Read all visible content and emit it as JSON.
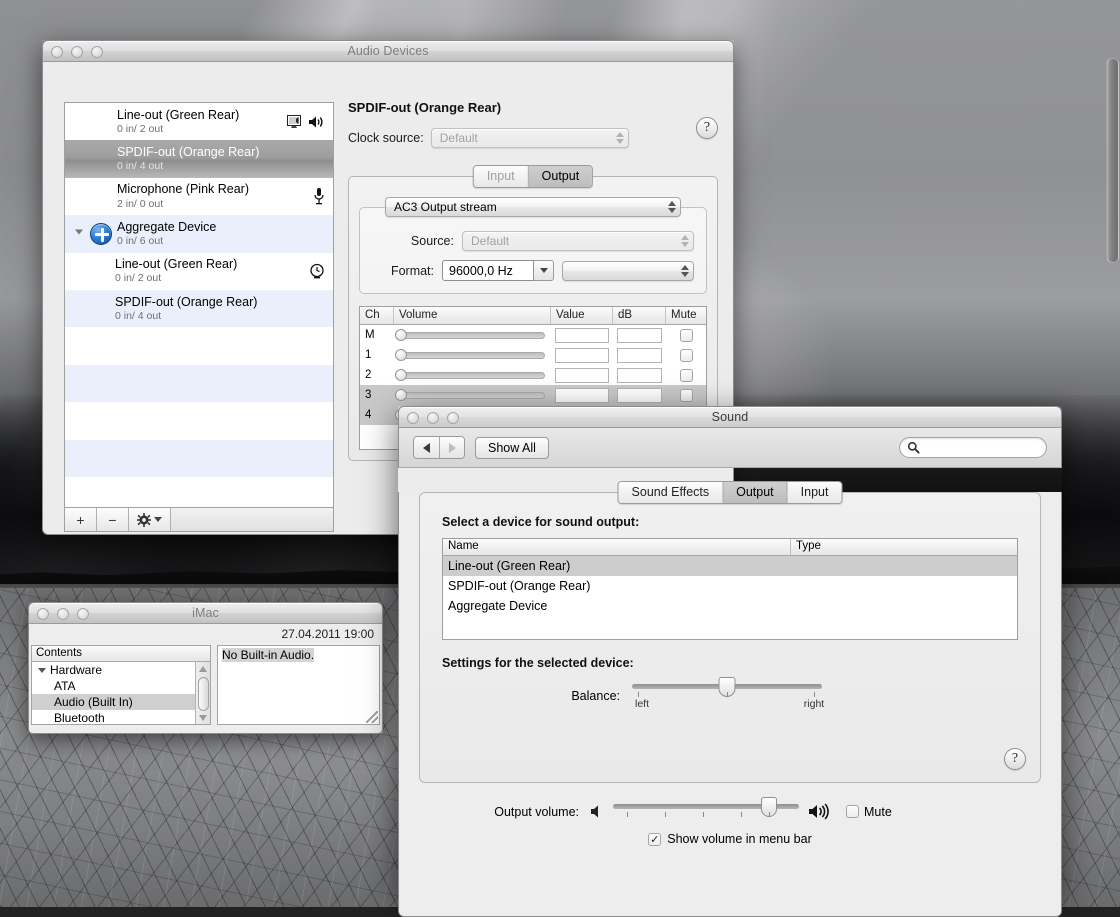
{
  "desktop": {
    "wallpaper_description": "black and white sky with sun rays over dark clouds and cracked desert floor",
    "scrollbar": "desktop-scrollbar-thumb"
  },
  "audio_devices_window": {
    "title": "Audio Devices",
    "traffic_lights": [
      "close",
      "minimize",
      "zoom"
    ],
    "device_list": [
      {
        "name": "Line-out (Green Rear)",
        "io": "0 in/ 2 out",
        "icon": "display-speaker-icon",
        "selected": false,
        "child": false,
        "alt": false
      },
      {
        "name": "SPDIF-out (Orange Rear)",
        "io": "0 in/ 4 out",
        "icon": "",
        "selected": true,
        "child": false,
        "alt": false
      },
      {
        "name": "Microphone (Pink Rear)",
        "io": "2 in/ 0 out",
        "icon": "microphone-icon",
        "selected": false,
        "child": false,
        "alt": false
      },
      {
        "name": "Aggregate Device",
        "io": "0 in/ 6 out",
        "icon": "aggregate-plus-icon",
        "selected": false,
        "child": false,
        "alt": true
      },
      {
        "name": "Line-out (Green Rear)",
        "io": "0 in/ 2 out",
        "icon": "clock-icon",
        "selected": false,
        "child": true,
        "alt": false
      },
      {
        "name": "SPDIF-out (Orange Rear)",
        "io": "0 in/ 4 out",
        "icon": "",
        "selected": false,
        "child": true,
        "alt": true
      }
    ],
    "toolbar": {
      "add_label": "+",
      "remove_label": "−",
      "gear_label": "gear"
    },
    "pane": {
      "device_title": "SPDIF-out (Orange Rear)",
      "clock_source_label": "Clock source:",
      "clock_source_value": "Default",
      "help_label": "?",
      "tabs": [
        {
          "label": "Input",
          "active": false,
          "disabled": true
        },
        {
          "label": "Output",
          "active": true,
          "disabled": false
        }
      ],
      "stream_value": "AC3 Output stream",
      "source_label": "Source:",
      "source_value": "Default",
      "format_label": "Format:",
      "format_value": "96000,0 Hz",
      "format_secondary_value": "",
      "channel_table": {
        "columns": [
          "Ch",
          "Volume",
          "Value",
          "dB",
          "Mute"
        ],
        "rows": [
          {
            "ch": "M",
            "value": "",
            "db": "",
            "mute": false,
            "selected": false
          },
          {
            "ch": "1",
            "value": "",
            "db": "",
            "mute": false,
            "selected": false
          },
          {
            "ch": "2",
            "value": "",
            "db": "",
            "mute": false,
            "selected": false
          },
          {
            "ch": "3",
            "value": "",
            "db": "",
            "mute": false,
            "selected": true
          },
          {
            "ch": "4",
            "value": "",
            "db": "",
            "mute": false,
            "selected": true
          }
        ]
      }
    }
  },
  "sound_window": {
    "title": "Sound",
    "toolbar": {
      "back_label": "◀",
      "forward_label": "▶",
      "show_all_label": "Show All",
      "search_placeholder": "",
      "search_value": ""
    },
    "tabs": [
      {
        "label": "Sound Effects",
        "active": false
      },
      {
        "label": "Output",
        "active": true
      },
      {
        "label": "Input",
        "active": false
      }
    ],
    "select_device_label": "Select a device for sound output:",
    "device_table": {
      "columns": [
        "Name",
        "Type"
      ],
      "rows": [
        {
          "name": "Line-out (Green Rear)",
          "type": "",
          "selected": true
        },
        {
          "name": "SPDIF-out (Orange Rear)",
          "type": "",
          "selected": false
        },
        {
          "name": "Aggregate Device",
          "type": "",
          "selected": false
        }
      ]
    },
    "settings_label": "Settings for the selected device:",
    "balance": {
      "label": "Balance:",
      "left_label": "left",
      "right_label": "right",
      "position_percent": 50
    },
    "help_label": "?",
    "output_volume": {
      "label": "Output volume:",
      "position_percent": 84,
      "mute_label": "Mute",
      "mute_checked": false,
      "low_icon": "speaker-low-icon",
      "high_icon": "speaker-high-icon"
    },
    "show_volume_menu_bar": {
      "label": "Show volume in menu bar",
      "checked": true,
      "check_glyph": "✓"
    }
  },
  "imac_window": {
    "title": "iMac",
    "date": "27.04.2011 19:00",
    "contents_header": "Contents",
    "tree": [
      {
        "label": "Hardware",
        "indent": false,
        "selected": false,
        "disclosure": true
      },
      {
        "label": "ATA",
        "indent": true,
        "selected": false,
        "disclosure": false
      },
      {
        "label": "Audio (Built In)",
        "indent": true,
        "selected": true,
        "disclosure": false
      },
      {
        "label": "Bluetooth",
        "indent": true,
        "selected": false,
        "disclosure": false
      }
    ],
    "detail_text": "No Built-in Audio."
  }
}
